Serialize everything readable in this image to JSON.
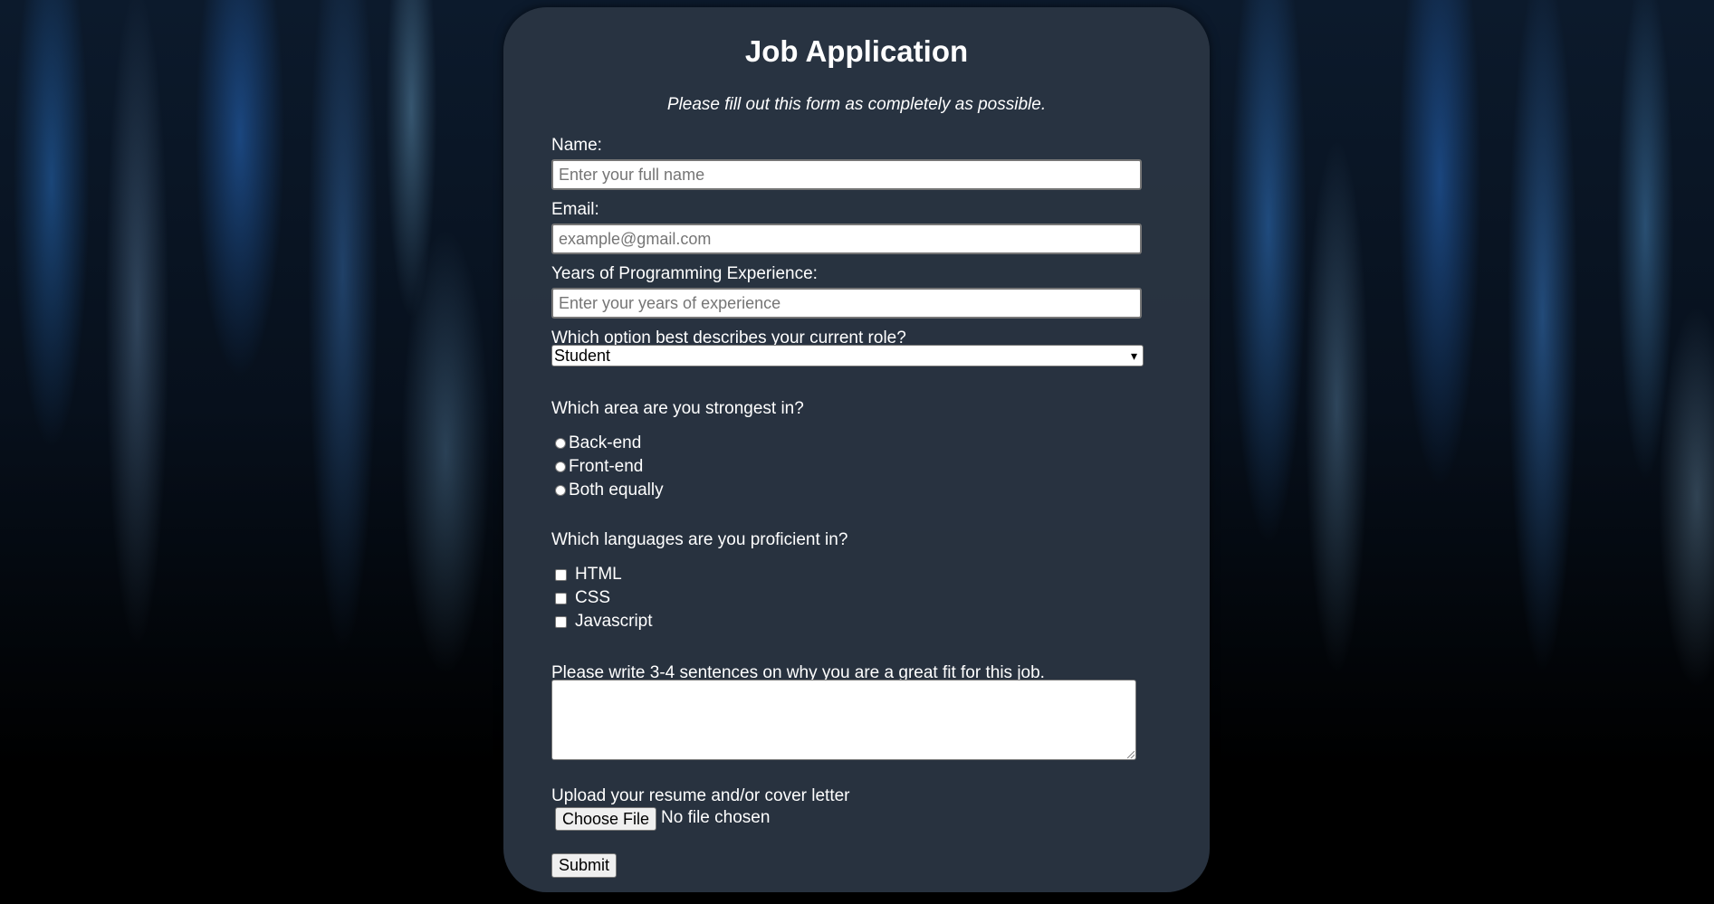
{
  "form": {
    "title": "Job Application",
    "subtitle": "Please fill out this form as completely as possible.",
    "name": {
      "label": "Name:",
      "placeholder": "Enter your full name",
      "value": ""
    },
    "email": {
      "label": "Email:",
      "placeholder": "example@gmail.com",
      "value": ""
    },
    "experience": {
      "label": "Years of Programming Experience:",
      "placeholder": "Enter your years of experience",
      "value": ""
    },
    "role": {
      "label": "Which option best describes your current role?",
      "selected": "Student",
      "chevron": "▾"
    },
    "strongest_area": {
      "label": "Which area are you strongest in?",
      "options": [
        "Back-end",
        "Front-end",
        "Both equally"
      ]
    },
    "languages": {
      "label": "Which languages are you proficient in?",
      "options": [
        "HTML",
        "CSS",
        "Javascript"
      ]
    },
    "fit_essay": {
      "label": "Please write 3-4 sentences on why you are a great fit for this job.",
      "value": ""
    },
    "upload": {
      "label": "Upload your resume and/or cover letter",
      "button": "Choose File",
      "status": "No file chosen"
    },
    "submit_label": "Submit"
  }
}
